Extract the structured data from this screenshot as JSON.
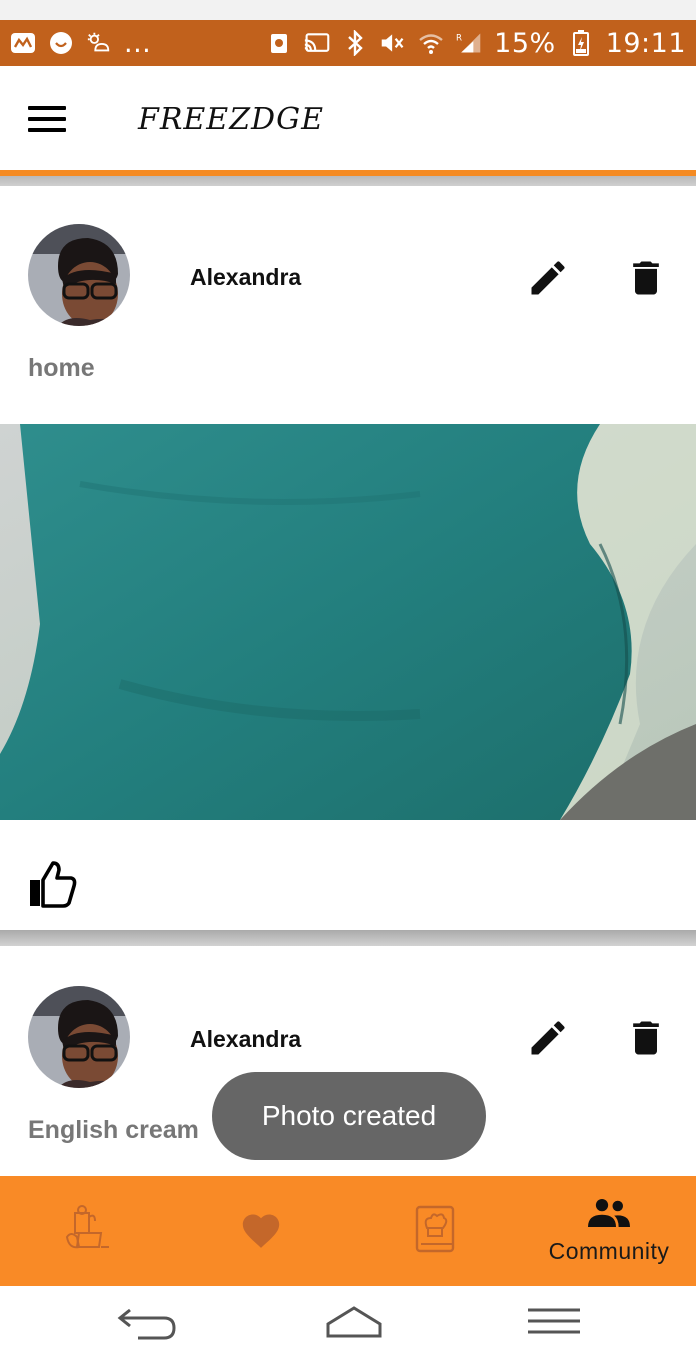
{
  "status_bar": {
    "left_more": "...",
    "battery_percent": "15%",
    "time": "19:11",
    "icons": [
      "mail-icon",
      "smiley-icon",
      "weather-icon",
      "notification-icon",
      "cast-icon",
      "bluetooth-icon",
      "mute-icon",
      "wifi-icon",
      "signal-icon",
      "battery-charging-icon"
    ],
    "color": "#c1611c"
  },
  "header": {
    "title": "FREEZDGE",
    "accent_color": "#f48a22"
  },
  "posts": [
    {
      "user": "Alexandra",
      "caption": "home",
      "icons": [
        "edit-icon",
        "delete-icon",
        "thumbs-up-icon"
      ]
    },
    {
      "user": "Alexandra",
      "caption": "English cream",
      "icons": [
        "edit-icon",
        "delete-icon"
      ]
    }
  ],
  "toast": {
    "message": "Photo created"
  },
  "bottom_nav": {
    "color": "#f98a26",
    "items": [
      {
        "icon": "fridge-food-icon",
        "label": ""
      },
      {
        "icon": "heart-icon",
        "label": ""
      },
      {
        "icon": "recipe-book-icon",
        "label": ""
      },
      {
        "icon": "community-icon",
        "label": "Community",
        "active": true
      }
    ]
  },
  "system_nav": {
    "icons": [
      "back-icon",
      "home-icon",
      "recents-icon"
    ]
  }
}
